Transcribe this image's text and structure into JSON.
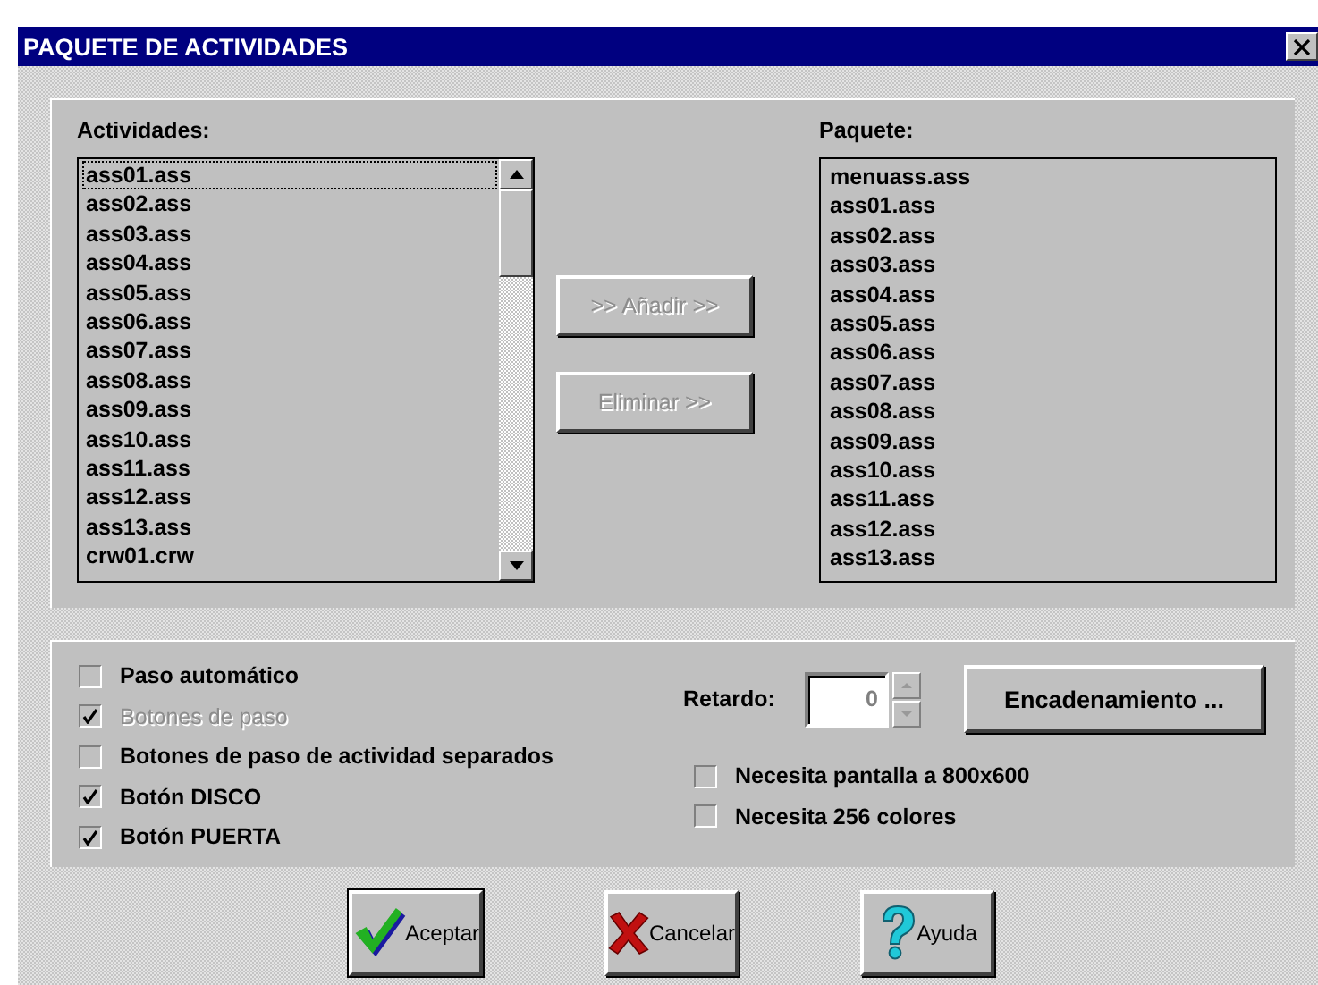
{
  "window": {
    "title": "PAQUETE DE ACTIVIDADES"
  },
  "activities": {
    "label": "Actividades:",
    "items": [
      {
        "text": "ass01.ass",
        "focused": true
      },
      {
        "text": "ass02.ass",
        "focused": false
      },
      {
        "text": "ass03.ass",
        "focused": false
      },
      {
        "text": "ass04.ass",
        "focused": false
      },
      {
        "text": "ass05.ass",
        "focused": false
      },
      {
        "text": "ass06.ass",
        "focused": false
      },
      {
        "text": "ass07.ass",
        "focused": false
      },
      {
        "text": "ass08.ass",
        "focused": false
      },
      {
        "text": "ass09.ass",
        "focused": false
      },
      {
        "text": "ass10.ass",
        "focused": false
      },
      {
        "text": "ass11.ass",
        "focused": false
      },
      {
        "text": "ass12.ass",
        "focused": false
      },
      {
        "text": "ass13.ass",
        "focused": false
      },
      {
        "text": "crw01.crw",
        "focused": false
      }
    ]
  },
  "transfer_buttons": [
    {
      "label": ">> Añadir >>",
      "disabled": true
    },
    {
      "label": "Eliminar >>",
      "disabled": true
    }
  ],
  "package": {
    "label": "Paquete:",
    "items": [
      "menuass.ass",
      "ass01.ass",
      "ass02.ass",
      "ass03.ass",
      "ass04.ass",
      "ass05.ass",
      "ass06.ass",
      "ass07.ass",
      "ass08.ass",
      "ass09.ass",
      "ass10.ass",
      "ass11.ass",
      "ass12.ass",
      "ass13.ass"
    ]
  },
  "options": [
    {
      "label": "Paso automático",
      "checked": false,
      "disabled": false
    },
    {
      "label": "Botones de paso",
      "checked": true,
      "disabled": true
    },
    {
      "label": "Botones de paso de actividad separados",
      "checked": false,
      "disabled": false
    },
    {
      "label": "Botón DISCO",
      "checked": true,
      "disabled": false
    },
    {
      "label": "Botón PUERTA",
      "checked": true,
      "disabled": false
    }
  ],
  "delay": {
    "label": "Retardo:",
    "value": "0"
  },
  "chain_button": "Encadenamiento ...",
  "requirements": [
    {
      "label": "Necesita pantalla a 800x600",
      "checked": false
    },
    {
      "label": "Necesita 256 colores",
      "checked": false
    }
  ],
  "buttons": [
    {
      "kind": "ok",
      "label": "Aceptar",
      "default": true
    },
    {
      "kind": "cancel",
      "label": "Cancelar",
      "default": false
    },
    {
      "kind": "help",
      "label": "Ayuda",
      "default": false
    }
  ]
}
